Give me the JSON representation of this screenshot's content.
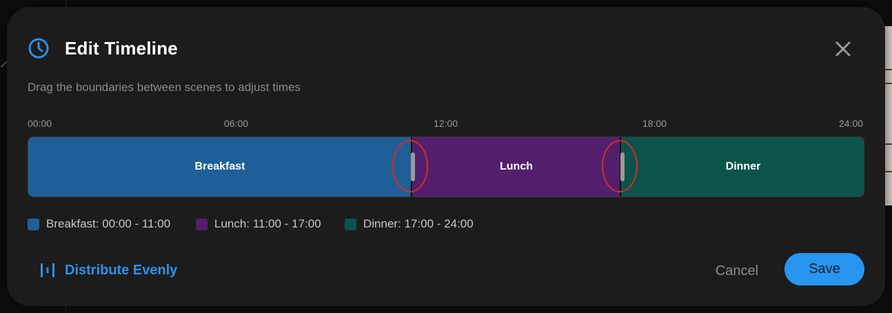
{
  "dialog": {
    "title": "Edit Timeline",
    "subtitle": "Drag the boundaries between scenes to adjust times",
    "icon": "clock-icon",
    "close_icon": "close-icon"
  },
  "timeline": {
    "ticks": [
      "00:00",
      "06:00",
      "12:00",
      "18:00",
      "24:00"
    ],
    "segments": [
      {
        "label": "Breakfast",
        "start": "00:00",
        "end": "11:00",
        "color": "#1e5f97"
      },
      {
        "label": "Lunch",
        "start": "11:00",
        "end": "17:00",
        "color": "#531f6d"
      },
      {
        "label": "Dinner",
        "start": "17:00",
        "end": "24:00",
        "color": "#0b544b"
      }
    ]
  },
  "legend": [
    {
      "text": "Breakfast: 00:00 - 11:00",
      "color": "#1e5f97"
    },
    {
      "text": "Lunch: 11:00 - 17:00",
      "color": "#531f6d"
    },
    {
      "text": "Dinner: 17:00 - 24:00",
      "color": "#0b544b"
    }
  ],
  "footer": {
    "distribute_label": "Distribute Evenly",
    "distribute_icon": "distribute-icon",
    "cancel_label": "Cancel",
    "save_label": "Save"
  },
  "colors": {
    "accent": "#2696f0",
    "highlight": "#d92a2a"
  }
}
